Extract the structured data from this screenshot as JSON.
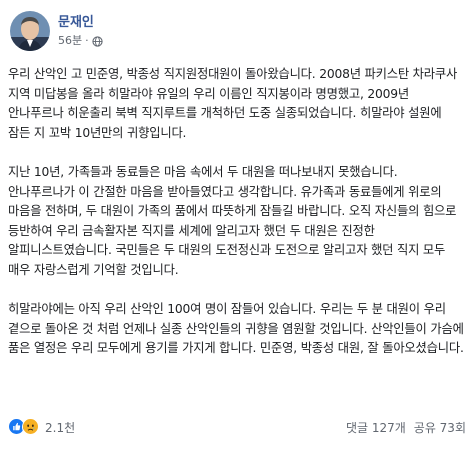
{
  "author": {
    "name": "문재인",
    "time": "56분",
    "separator": "·"
  },
  "post": {
    "paragraphs": [
      "우리 산악인 고 민준영, 박종성 직지원정대원이 돌아왔습니다. 2008년 파키스탄 차라쿠사 지역 미답봉을 올라 히말라야 유일의 우리 이름인 직지봉이라 명명했고, 2009년 안나푸르나 히운출리 북벽 직지루트를 개척하던 도중 실종되었습니다. 히말라야 설원에 잠든 지 꼬박 10년만의 귀향입니다.",
      "지난 10년, 가족들과 동료들은 마음 속에서 두 대원을 떠나보내지 못했습니다. 안나푸르나가 이 간절한 마음을 받아들였다고 생각합니다. 유가족과 동료들에게 위로의 마음을 전하며, 두 대원이 가족의 품에서 따뜻하게 잠들길 바랍니다. 오직 자신들의 힘으로 등반하여 우리 금속활자본 직지를 세계에 알리고자 했던 두 대원은 진정한 알피니스트였습니다. 국민들은 두 대원의 도전정신과 도전으로 알리고자 했던 직지 모두 매우 자랑스럽게 기억할 것입니다.",
      "히말라야에는 아직 우리 산악인 100여 명이 잠들어 있습니다. 우리는 두 분 대원이 우리 곁으로 돌아온 것 처럼 언제나 실종 산악인들의 귀향을 염원할 것입니다. 산악인들이 가슴에 품은 열정은 우리 모두에게 용기를 가지게 합니다. 민준영, 박종성 대원, 잘 돌아오셨습니다."
    ]
  },
  "footer": {
    "reaction_icons": [
      "like-icon",
      "sad-icon"
    ],
    "reaction_count": "2.1천",
    "comments": "댓글 127개",
    "shares": "공유 73회"
  },
  "colors": {
    "author": "#385898",
    "meta": "#616770",
    "text": "#1c1e21",
    "like": "#1877f2",
    "sad": "#f7b125"
  }
}
